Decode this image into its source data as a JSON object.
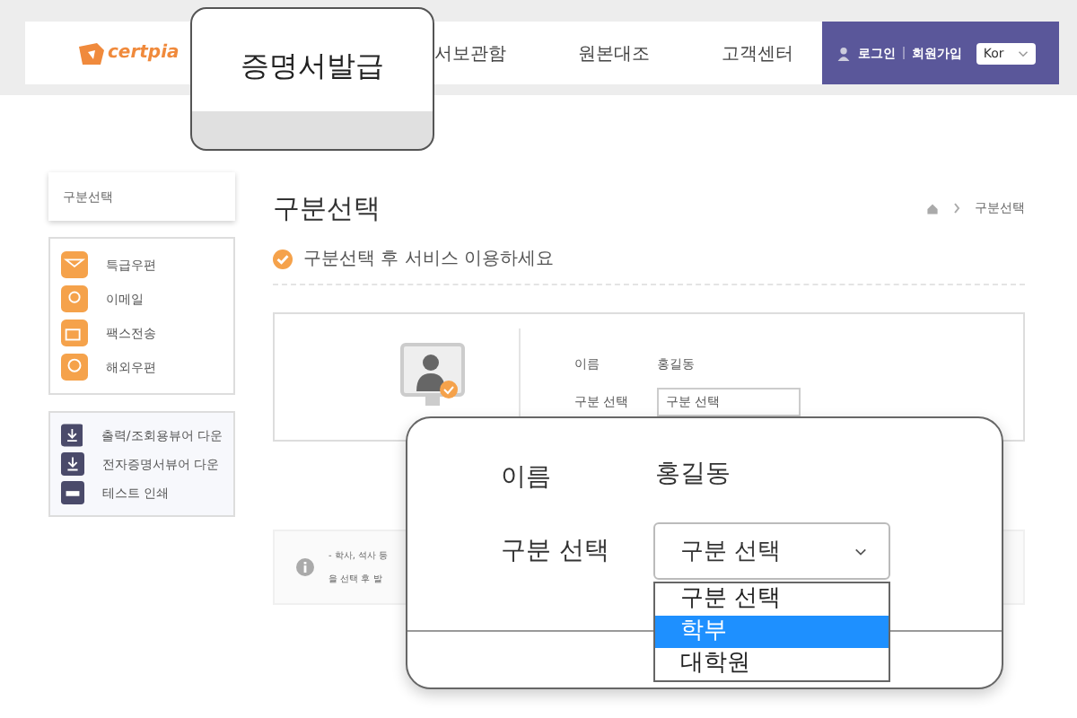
{
  "header": {
    "logo": "certpia",
    "nav": [
      {
        "label": "서보관함"
      },
      {
        "label": "원본대조"
      },
      {
        "label": "고객센터"
      }
    ],
    "login": "로그인",
    "signup": "회원가입",
    "language": "Kor"
  },
  "nav_callout": {
    "label": "증명서발급"
  },
  "sidebar": {
    "current": "구분선택",
    "delivery": [
      {
        "label": "특급우편",
        "kind": "express"
      },
      {
        "label": "이메일",
        "kind": "email"
      },
      {
        "label": "팩스전송",
        "kind": "fax"
      },
      {
        "label": "해외우편",
        "kind": "overseas"
      }
    ],
    "downloads": [
      {
        "label": "출력/조회용뷰어 다운",
        "kind": "download"
      },
      {
        "label": "전자증명서뷰어 다운",
        "kind": "download"
      },
      {
        "label": "테스트 인쇄",
        "kind": "print"
      }
    ]
  },
  "page": {
    "title": "구분선택",
    "breadcrumb": "구분선택",
    "notice": "구분선택 후 서비스 이용하세요"
  },
  "form": {
    "name_label": "이름",
    "name_value": "홍길동",
    "type_label": "구분 선택",
    "type_value": "구분 선택"
  },
  "info": {
    "lines": [
      "- 학사, 석사 등",
      "을 선택 후 발"
    ]
  },
  "zoom_callout": {
    "name_label": "이름",
    "name_value": "홍길동",
    "type_label": "구분 선택",
    "type_value": "구분 선택",
    "options": [
      {
        "label": "구분 선택",
        "selected": false
      },
      {
        "label": "학부",
        "selected": true
      },
      {
        "label": "대학원",
        "selected": false
      }
    ]
  }
}
